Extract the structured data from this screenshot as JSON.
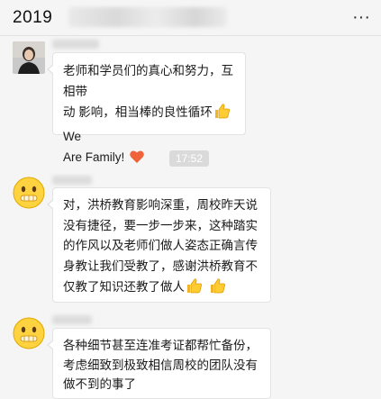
{
  "window": {
    "title": "2019"
  },
  "messages": [
    {
      "lines": [
        "老师和学员们的真心和努力，互相带",
        "动 影响，相当棒的良性循环",
        "We",
        "Are Family!"
      ],
      "emojis": [
        "thumbs-up",
        "heart"
      ]
    },
    {
      "lines": [
        "对，洪桥教育影响深重，周校昨天说",
        "没有捷径，要一步一步来，这种踏实",
        "的作风以及老师们做人姿态正确言传",
        "身教让我们受教了，感谢洪桥教育不",
        "仅教了知识还教了做人"
      ],
      "emojis": [
        "thumbs-up",
        "thumbs-up"
      ]
    },
    {
      "lines": [
        "各种细节甚至连准考证都帮忙备份，",
        "考虑细致到极致相信周校的团队没有",
        "做不到的事了"
      ],
      "emojis": []
    }
  ],
  "timestamp": "17:52",
  "icons": {
    "more": "more-icon",
    "thumbs_up": "thumbs-up-icon",
    "heart": "heart-icon",
    "avatar_emoji": "silent-face-icon"
  },
  "colors": {
    "background": "#f5f5f5",
    "bubble": "#ffffff",
    "timestamp_bg": "#dadada"
  }
}
